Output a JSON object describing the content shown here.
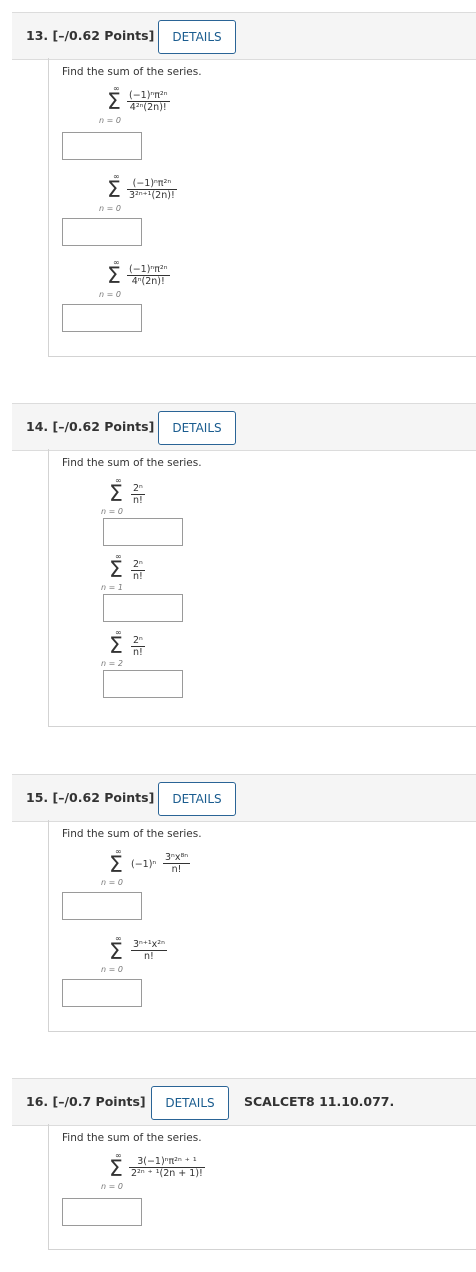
{
  "questions": [
    {
      "number": "13.",
      "points": "[–/0.62 Points]",
      "details_label": "DETAILS",
      "prompt": "Find the sum of the series.",
      "parts": [
        {
          "upper": "∞",
          "lower": "n = 0",
          "numerator": "(−1)ⁿπ²ⁿ",
          "denominator": "4²ⁿ(2n)!"
        },
        {
          "upper": "∞",
          "lower": "n = 0",
          "numerator": "(−1)ⁿπ²ⁿ",
          "denominator": "3²ⁿ⁺¹(2n)!"
        },
        {
          "upper": "∞",
          "lower": "n = 0",
          "numerator": "(−1)ⁿπ²ⁿ",
          "denominator": "4ⁿ(2n)!"
        }
      ]
    },
    {
      "number": "14.",
      "points": "[–/0.62 Points]",
      "details_label": "DETAILS",
      "prompt": "Find the sum of the series.",
      "parts": [
        {
          "upper": "∞",
          "lower": "n = 0",
          "numerator": "2ⁿ",
          "denominator": "n!"
        },
        {
          "upper": "∞",
          "lower": "n = 1",
          "numerator": "2ⁿ",
          "denominator": "n!"
        },
        {
          "upper": "∞",
          "lower": "n = 2",
          "numerator": "2ⁿ",
          "denominator": "n!"
        }
      ]
    },
    {
      "number": "15.",
      "points": "[–/0.62 Points]",
      "details_label": "DETAILS",
      "prompt": "Find the sum of the series.",
      "parts": [
        {
          "upper": "∞",
          "lower": "n = 0",
          "prefix": "(−1)ⁿ",
          "numerator": "3ⁿx⁸ⁿ",
          "denominator": "n!"
        },
        {
          "upper": "∞",
          "lower": "n = 0",
          "numerator": "3ⁿ⁺¹x²ⁿ",
          "denominator": "n!"
        }
      ]
    },
    {
      "number": "16.",
      "points": "[–/0.7 Points]",
      "details_label": "DETAILS",
      "code": "SCALCET8 11.10.077.",
      "prompt": "Find the sum of the series.",
      "parts": [
        {
          "upper": "∞",
          "lower": "n = 0",
          "numerator": "3(−1)ⁿπ²ⁿ ⁺ ¹",
          "denominator": "2²ⁿ ⁺ ¹(2n + 1)!"
        }
      ]
    }
  ]
}
